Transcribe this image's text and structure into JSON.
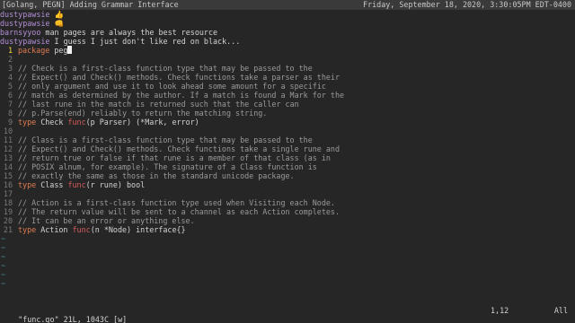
{
  "topbar": {
    "tag": "[Golang, PEGN] Adding Grammar Interface",
    "clock": "Friday, September 18, 2020, 3:30:05PM EDT-0400"
  },
  "chat": [
    {
      "nick": "dustypawsie",
      "msg": "",
      "emoji": "👍"
    },
    {
      "nick": "dustypawsie",
      "msg": "",
      "emoji": "👊"
    },
    {
      "nick": "barnsyyoo",
      "msg": " man pages are always the best resource",
      "emoji": ""
    },
    {
      "nick": "dustypawsie",
      "msg": " I guess I just don't like red on black...",
      "emoji": ""
    }
  ],
  "editor": {
    "current_line": "1",
    "first_line": {
      "kw": "package",
      "ident": " peg",
      "tail": "n"
    },
    "comments": {
      "l3": "// Check is a first-class function type that may be passed to the",
      "l4": "// Expect() and Check() methods. Check functions take a parser as their",
      "l5": "// only argument and use it to look ahead some amount for a specific",
      "l6": "// match as determined by the author. If a match is found a Mark for the",
      "l7": "// last rune in the match is returned such that the caller can",
      "l8": "// p.Parse(end) reliably to return the matching string.",
      "l11": "// Class is a first-class function type that may be passed to the",
      "l12": "// Expect() and Check() methods. Check functions take a single rune and",
      "l13": "// return true or false if that rune is a member of that class (as in",
      "l14": "// POSIX alnum, for example). The signature of a Class function is",
      "l15": "// exactly the same as those in the standard unicode package.",
      "l18": "// Action is a first-class function type used when Visiting each Node.",
      "l19": "// The return value will be sent to a channel as each Action completes.",
      "l20": "// It can be an error or anything else."
    },
    "decl9": {
      "kw": "type",
      "name": " Check ",
      "fn": "func",
      "rest": "(p Parser) (*Mark, error)"
    },
    "decl16": {
      "kw": "type",
      "name": " Class ",
      "fn": "func",
      "rest": "(r rune) bool"
    },
    "decl21": {
      "kw": "type",
      "name": " Action ",
      "fn": "func",
      "rest": "(n *Node) interface{}"
    },
    "tilde": "~"
  },
  "statusline": {
    "file": "\"func.go\" 21L, 1043C [w]",
    "position": "1,12",
    "percent": "All"
  }
}
